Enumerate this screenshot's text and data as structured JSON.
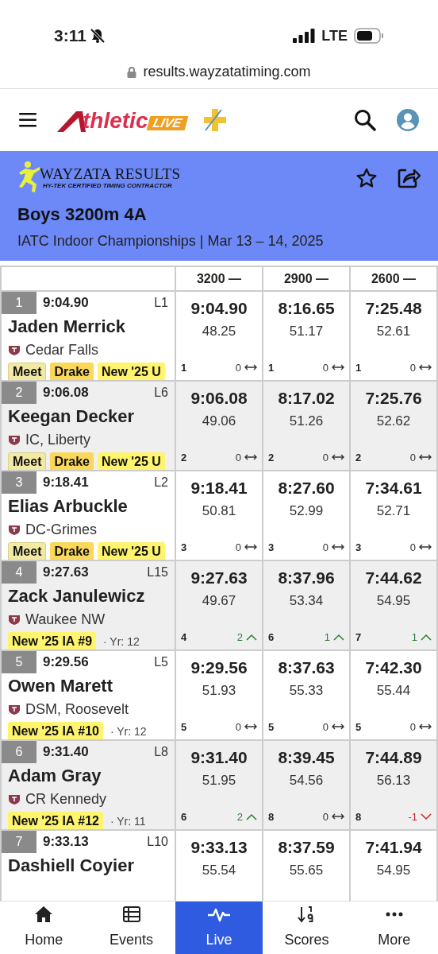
{
  "status_bar": {
    "time": "3:11",
    "network": "LTE"
  },
  "address_bar": {
    "url": "results.wayzatatiming.com"
  },
  "header": {
    "logo_text": "thletic",
    "logo_badge": "LIVE"
  },
  "banner": {
    "logo_text": "WAYZATA RESULTS",
    "logo_tagline": "HY-TEK CERTIFIED TIMING CONTRACTOR",
    "title": "Boys 3200m 4A",
    "subtitle": "IATC Indoor Championships | Mar 13 – 14, 2025"
  },
  "table": {
    "columns": [
      "3200 —",
      "2900 —",
      "2600 —"
    ],
    "rows": [
      {
        "place": "1",
        "time": "9:04.90",
        "lane": "L1",
        "name": "Jaden Merrick",
        "team": "Cedar Falls",
        "tags": [
          {
            "label": "Meet",
            "kind": "meet"
          },
          {
            "label": "Drake",
            "kind": "drake"
          },
          {
            "label": "New '25 U",
            "kind": "rank"
          }
        ],
        "splits": [
          {
            "time": "9:04.90",
            "lap": "48.25",
            "place": "1",
            "change": "0",
            "kind": "same"
          },
          {
            "time": "8:16.65",
            "lap": "51.17",
            "place": "1",
            "change": "0",
            "kind": "same"
          },
          {
            "time": "7:25.48",
            "lap": "52.61",
            "place": "1",
            "change": "0",
            "kind": "same"
          }
        ]
      },
      {
        "place": "2",
        "time": "9:06.08",
        "lane": "L6",
        "name": "Keegan Decker",
        "team": "IC, Liberty",
        "tags": [
          {
            "label": "Meet",
            "kind": "meet"
          },
          {
            "label": "Drake",
            "kind": "drake"
          },
          {
            "label": "New '25 U",
            "kind": "rank"
          }
        ],
        "splits": [
          {
            "time": "9:06.08",
            "lap": "49.06",
            "place": "2",
            "change": "0",
            "kind": "same"
          },
          {
            "time": "8:17.02",
            "lap": "51.26",
            "place": "2",
            "change": "0",
            "kind": "same"
          },
          {
            "time": "7:25.76",
            "lap": "52.62",
            "place": "2",
            "change": "0",
            "kind": "same"
          }
        ]
      },
      {
        "place": "3",
        "time": "9:18.41",
        "lane": "L2",
        "name": "Elias Arbuckle",
        "team": "DC-Grimes",
        "tags": [
          {
            "label": "Meet",
            "kind": "meet"
          },
          {
            "label": "Drake",
            "kind": "drake"
          },
          {
            "label": "New '25 U",
            "kind": "rank"
          }
        ],
        "splits": [
          {
            "time": "9:18.41",
            "lap": "50.81",
            "place": "3",
            "change": "0",
            "kind": "same"
          },
          {
            "time": "8:27.60",
            "lap": "52.99",
            "place": "3",
            "change": "0",
            "kind": "same"
          },
          {
            "time": "7:34.61",
            "lap": "52.71",
            "place": "3",
            "change": "0",
            "kind": "same"
          }
        ]
      },
      {
        "place": "4",
        "time": "9:27.63",
        "lane": "L15",
        "name": "Zack Janulewicz",
        "team": "Waukee NW",
        "tags": [
          {
            "label": "New '25 IA #9",
            "kind": "rank"
          }
        ],
        "year": "· Yr: 12",
        "splits": [
          {
            "time": "9:27.63",
            "lap": "49.67",
            "place": "4",
            "change": "2",
            "kind": "up"
          },
          {
            "time": "8:37.96",
            "lap": "53.34",
            "place": "6",
            "change": "1",
            "kind": "up"
          },
          {
            "time": "7:44.62",
            "lap": "54.95",
            "place": "7",
            "change": "1",
            "kind": "up"
          }
        ]
      },
      {
        "place": "5",
        "time": "9:29.56",
        "lane": "L5",
        "name": "Owen Marett",
        "team": "DSM, Roosevelt",
        "tags": [
          {
            "label": "New '25 IA #10",
            "kind": "rank"
          }
        ],
        "year": "· Yr: 12",
        "splits": [
          {
            "time": "9:29.56",
            "lap": "51.93",
            "place": "5",
            "change": "0",
            "kind": "same"
          },
          {
            "time": "8:37.63",
            "lap": "55.33",
            "place": "5",
            "change": "0",
            "kind": "same"
          },
          {
            "time": "7:42.30",
            "lap": "55.44",
            "place": "5",
            "change": "0",
            "kind": "same"
          }
        ]
      },
      {
        "place": "6",
        "time": "9:31.40",
        "lane": "L8",
        "name": "Adam Gray",
        "team": "CR Kennedy",
        "tags": [
          {
            "label": "New '25 IA #12",
            "kind": "rank"
          }
        ],
        "year": "· Yr: 11",
        "splits": [
          {
            "time": "9:31.40",
            "lap": "51.95",
            "place": "6",
            "change": "2",
            "kind": "up"
          },
          {
            "time": "8:39.45",
            "lap": "54.56",
            "place": "8",
            "change": "0",
            "kind": "same"
          },
          {
            "time": "7:44.89",
            "lap": "56.13",
            "place": "8",
            "change": "-1",
            "kind": "down"
          }
        ]
      },
      {
        "place": "7",
        "time": "9:33.13",
        "lane": "L10",
        "name": "Dashiell Coyier",
        "splits": [
          {
            "time": "9:33.13",
            "lap": "55.54"
          },
          {
            "time": "8:37.59",
            "lap": "55.65"
          },
          {
            "time": "7:41.94",
            "lap": "54.95"
          }
        ]
      }
    ]
  },
  "bottom_nav": [
    {
      "label": "Home",
      "selected": false
    },
    {
      "label": "Events",
      "selected": false
    },
    {
      "label": "Live",
      "selected": true
    },
    {
      "label": "Scores",
      "selected": false
    },
    {
      "label": "More",
      "selected": false
    }
  ]
}
